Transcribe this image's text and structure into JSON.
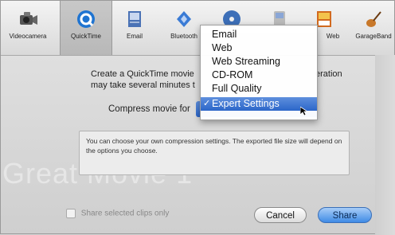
{
  "toolbar": {
    "items": [
      {
        "label": "Videocamera",
        "icon": "videocamera-icon"
      },
      {
        "label": "QuickTime",
        "icon": "quicktime-icon"
      },
      {
        "label": "Email",
        "icon": "email-icon"
      },
      {
        "label": "Bluetooth",
        "icon": "bluetooth-icon"
      },
      {
        "label": "",
        "icon": "cdrom-icon"
      },
      {
        "label": "",
        "icon": "ipod-icon"
      },
      {
        "label": "Web",
        "icon": "web-icon"
      },
      {
        "label": "GarageBand",
        "icon": "garageband-icon"
      }
    ],
    "selected": "QuickTime"
  },
  "sheet": {
    "description": "Create a QuickTime movie ... eration may take several minutes t...",
    "desc_line1": "Create a QuickTime movie",
    "desc_line1_tail": "eration",
    "desc_line2": "may take several minutes t",
    "compress_label": "Compress movie for",
    "info_text": "You can choose your own compression settings. The exported file size will depend on the options you choose.",
    "ghost_title": "Great Movie 1",
    "share_selected_clips_label": "Share selected clips only",
    "cancel_label": "Cancel",
    "share_label": "Share"
  },
  "popup_menu": {
    "items": [
      "Email",
      "Web",
      "Web Streaming",
      "CD-ROM",
      "Full Quality"
    ],
    "selected": "Expert Settings",
    "check": "✓"
  },
  "colors": {
    "selection_blue": "#2b66c9",
    "share_button": "#3f8be6"
  }
}
